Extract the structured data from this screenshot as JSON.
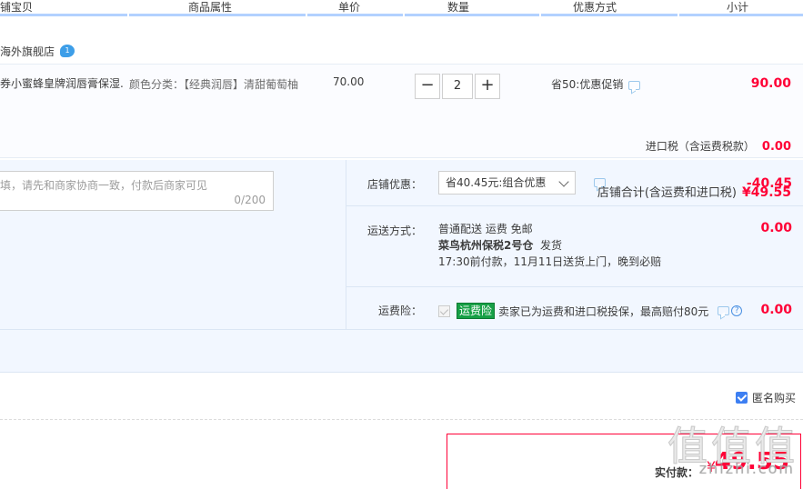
{
  "header": {
    "columns": [
      "铺宝贝",
      "商品属性",
      "单价",
      "数量",
      "优惠方式",
      "小计"
    ]
  },
  "shop": {
    "name": "海外旗舰店",
    "badge": "1"
  },
  "item": {
    "title": "券小蜜蜂皇牌润唇膏保湿...",
    "attr_label": "颜色分类：",
    "attr_value": "【经典润唇】清甜葡萄柚",
    "unit_price": "70.00",
    "quantity": "2",
    "qty_minus": "−",
    "qty_plus": "+",
    "promo": "省50:优惠促销",
    "subtotal": "90.00",
    "import_tax_label": "进口税（含运费税款）",
    "import_tax_value": "0.00"
  },
  "message": {
    "placeholder": "填，请先和商家协商一致，付款后商家可见",
    "count": "0/200"
  },
  "shop_discount": {
    "label": "店铺优惠：",
    "selected": "省40.45元:组合优惠",
    "amount": "-40.45"
  },
  "shipping": {
    "label": "运送方式：",
    "line1": "普通配送 运费 免邮",
    "warehouse": "菜鸟杭州保税2号仓",
    "ship_text": "发货",
    "line3": "17:30前付款，11月11日送货上门，晚到必赔",
    "amount": "0.00"
  },
  "insurance": {
    "label": "运费险：",
    "tag": "运费险",
    "text": "卖家已为运费和进口税投保，最高赔付80元",
    "help": "?",
    "amount": "0.00"
  },
  "shop_total": {
    "label": "店铺合计(含运费和进口税)",
    "value": "¥49.55"
  },
  "anonymous": {
    "label": "匿名购买",
    "checked": true
  },
  "payment": {
    "label": "实付款：",
    "currency": "¥",
    "amount": "49.55"
  },
  "watermark": {
    "big": "值值值",
    "small": "zhizhi.com"
  },
  "colors": {
    "price_red": "#ff0036",
    "header_border": "#b2d1ff",
    "panel_bg": "#f2f7ff",
    "insurance_green": "#17a046",
    "checkbox_blue": "#3d7ff2"
  }
}
